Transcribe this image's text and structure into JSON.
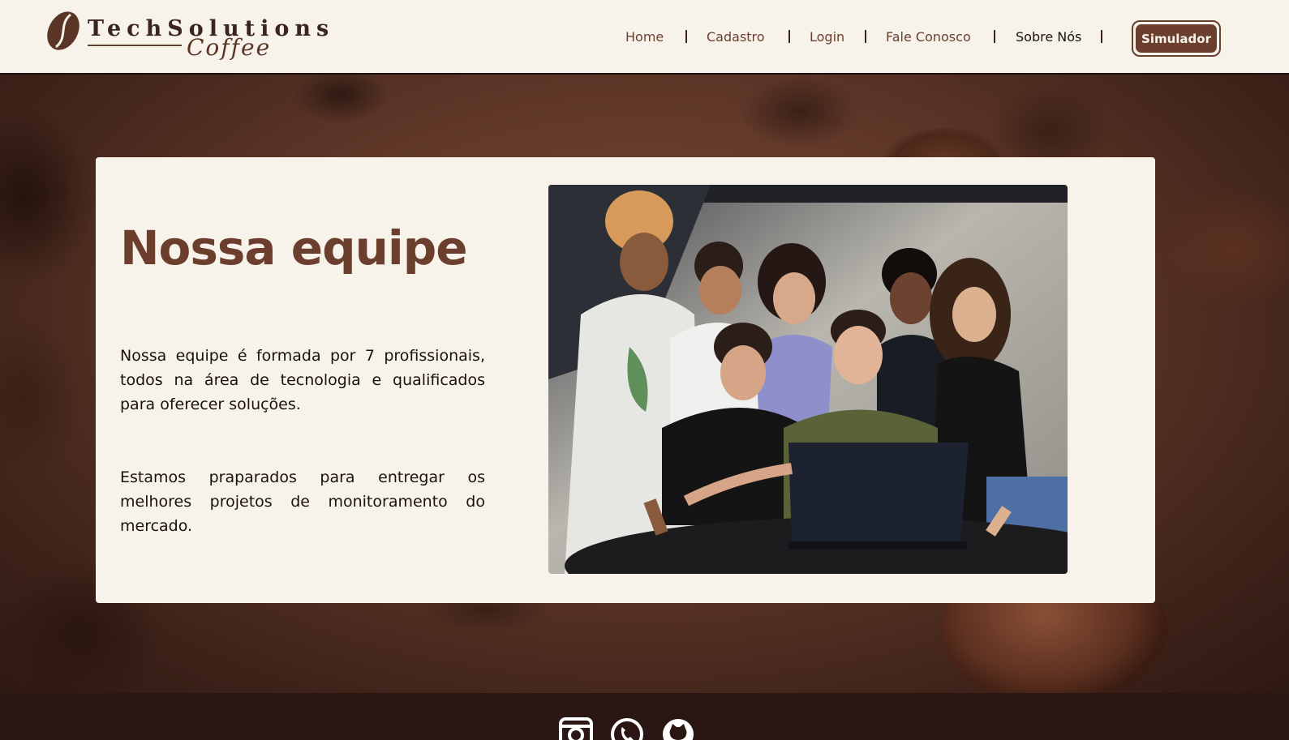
{
  "brand": {
    "name": "TechSolutions",
    "tagline": "Coffee"
  },
  "nav": {
    "items": [
      {
        "label": "Home"
      },
      {
        "label": "Cadastro"
      },
      {
        "label": "Login"
      },
      {
        "label": "Fale Conosco"
      },
      {
        "label": "Sobre Nós",
        "active": true
      }
    ],
    "cta_label": "Simulador"
  },
  "section": {
    "title": "Nossa equipe",
    "paragraph1": "Nossa equipe é formada por 7 profissionais, todos na área de tecnologia e qualificados para oferecer soluções.",
    "paragraph2": "Estamos praparados para entregar os melhores projetos de monitoramento do mercado."
  },
  "footer": {
    "social": [
      {
        "icon": "instagram-icon"
      },
      {
        "icon": "whatsapp-icon"
      },
      {
        "icon": "github-icon"
      }
    ]
  },
  "colors": {
    "brand_brown": "#6b3e2e",
    "header_bg": "#f7f3eb",
    "footer_bg": "#2a1714",
    "text_dark": "#1c1110"
  }
}
